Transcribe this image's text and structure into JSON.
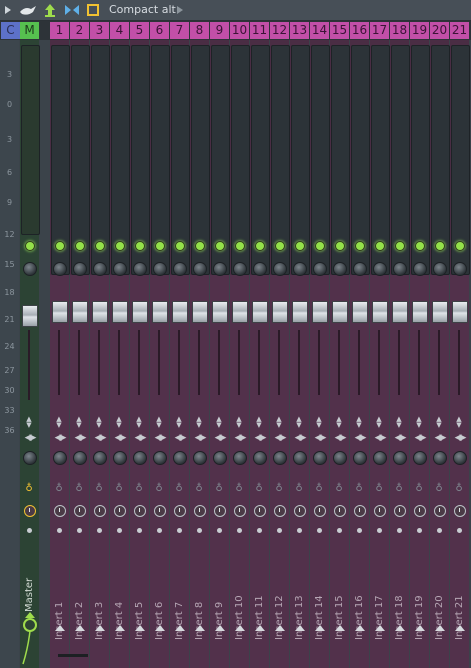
{
  "toolbar": {
    "preset_label": "Compact alt",
    "icons": [
      "menu-arrow-icon",
      "mixer-bird-icon",
      "hint-icon",
      "link-icon",
      "view-box-icon",
      "forward-arrow-icon"
    ]
  },
  "header": {
    "current_label": "C",
    "master_label": "M",
    "insert_numbers": [
      "1",
      "2",
      "3",
      "4",
      "5",
      "6",
      "7",
      "8",
      "9",
      "10",
      "11",
      "12",
      "13",
      "14",
      "15",
      "16",
      "17",
      "18",
      "19",
      "20",
      "21"
    ]
  },
  "meter_scale": [
    "3",
    "0",
    "3",
    "6",
    "9",
    "12",
    "15",
    "18",
    "21",
    "24",
    "27",
    "30",
    "33",
    "36"
  ],
  "master": {
    "name": "Master"
  },
  "inserts": [
    "Insert 1",
    "Insert 2",
    "Insert 3",
    "Insert 4",
    "Insert 5",
    "Insert 6",
    "Insert 7",
    "Insert 8",
    "Insert 9",
    "Insert 10",
    "Insert 11",
    "Insert 12",
    "Insert 13",
    "Insert 14",
    "Insert 15",
    "Insert 16",
    "Insert 17",
    "Insert 18",
    "Insert 19",
    "Insert 20",
    "Insert 21"
  ],
  "colors": {
    "current_header": "#5d71c8",
    "master_header": "#56c04f",
    "insert_header": "#c24fa8",
    "insert_body": "#4a2d44",
    "led_on": "#93e04a",
    "master_body": "#2c4334"
  }
}
